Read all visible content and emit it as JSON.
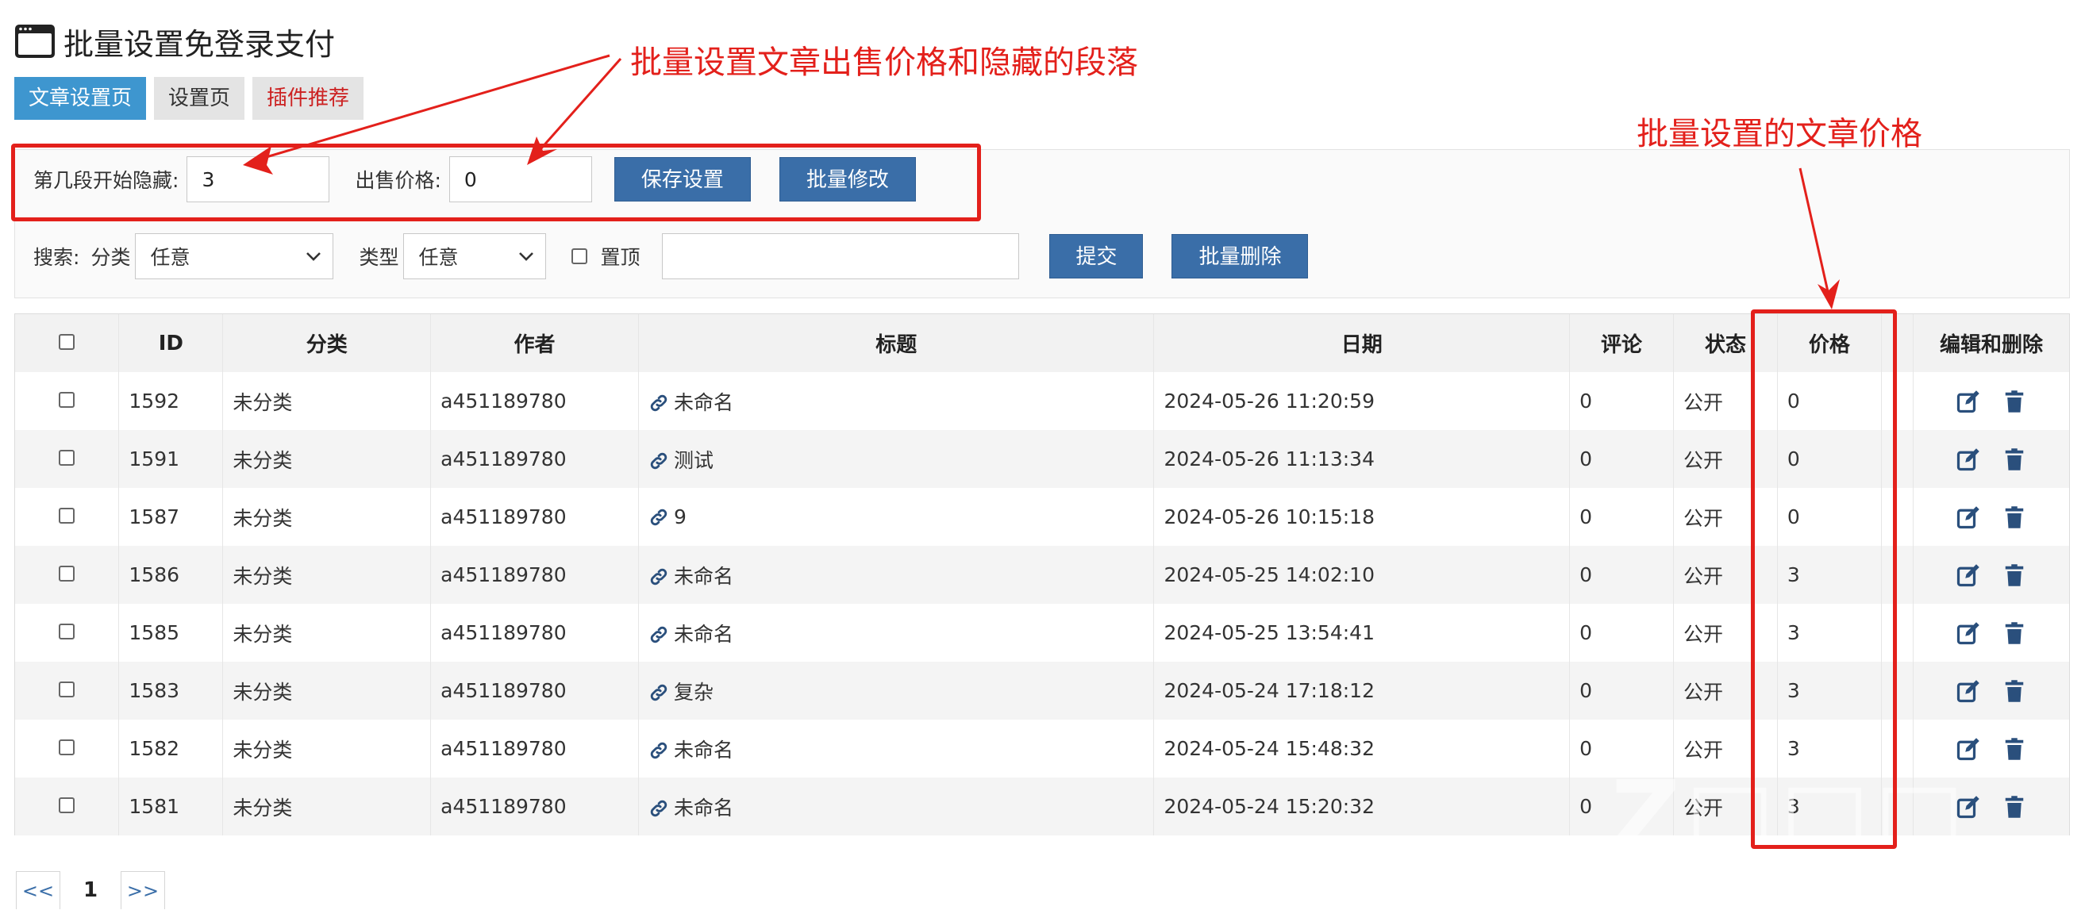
{
  "page": {
    "title": "批量设置免登录支付"
  },
  "tabs": [
    {
      "label": "文章设置页",
      "active": true
    },
    {
      "label": "设置页",
      "active": false
    },
    {
      "label": "插件推荐",
      "active": false
    }
  ],
  "settings": {
    "hide_label": "第几段开始隐藏:",
    "hide_value": "3",
    "price_label": "出售价格:",
    "price_value": "0",
    "save_label": "保存设置",
    "batch_edit_label": "批量修改"
  },
  "search": {
    "search_label": "搜索:",
    "category_label": "分类",
    "category_value": "任意",
    "type_label": "类型",
    "type_value": "任意",
    "top_label": "置顶",
    "keyword_value": "",
    "submit_label": "提交",
    "batch_delete_label": "批量删除"
  },
  "table": {
    "headers": {
      "id": "ID",
      "category": "分类",
      "author": "作者",
      "title": "标题",
      "date": "日期",
      "comments": "评论",
      "status": "状态",
      "price": "价格",
      "actions": "编辑和删除"
    },
    "rows": [
      {
        "id": "1592",
        "category": "未分类",
        "author": "a451189780",
        "title": "未命名",
        "date": "2024-05-26 11:20:59",
        "comments": "0",
        "status": "公开",
        "price": "0"
      },
      {
        "id": "1591",
        "category": "未分类",
        "author": "a451189780",
        "title": "测试",
        "date": "2024-05-26 11:13:34",
        "comments": "0",
        "status": "公开",
        "price": "0"
      },
      {
        "id": "1587",
        "category": "未分类",
        "author": "a451189780",
        "title": "9",
        "date": "2024-05-26 10:15:18",
        "comments": "0",
        "status": "公开",
        "price": "0"
      },
      {
        "id": "1586",
        "category": "未分类",
        "author": "a451189780",
        "title": "未命名",
        "date": "2024-05-25 14:02:10",
        "comments": "0",
        "status": "公开",
        "price": "3"
      },
      {
        "id": "1585",
        "category": "未分类",
        "author": "a451189780",
        "title": "未命名",
        "date": "2024-05-25 13:54:41",
        "comments": "0",
        "status": "公开",
        "price": "3"
      },
      {
        "id": "1583",
        "category": "未分类",
        "author": "a451189780",
        "title": "复杂",
        "date": "2024-05-24 17:18:12",
        "comments": "0",
        "status": "公开",
        "price": "3"
      },
      {
        "id": "1582",
        "category": "未分类",
        "author": "a451189780",
        "title": "未命名",
        "date": "2024-05-24 15:48:32",
        "comments": "0",
        "status": "公开",
        "price": "3"
      },
      {
        "id": "1581",
        "category": "未分类",
        "author": "a451189780",
        "title": "未命名",
        "date": "2024-05-24 15:20:32",
        "comments": "0",
        "status": "公开",
        "price": "3"
      }
    ]
  },
  "pagination": {
    "prev": "<<",
    "current": "1",
    "next": ">>"
  },
  "annotations": {
    "top_note": "批量设置文章出售价格和隐藏的段落",
    "price_note": "批量设置的文章价格"
  },
  "colors": {
    "primary_button": "#3a6ea8",
    "active_tab": "#3e96cf",
    "annotation_red": "#e3201b"
  },
  "icons": {
    "title": "window-icon",
    "title_link": "link-icon",
    "edit": "edit-icon",
    "delete": "trash-icon",
    "dropdown": "chevron-down-icon"
  }
}
